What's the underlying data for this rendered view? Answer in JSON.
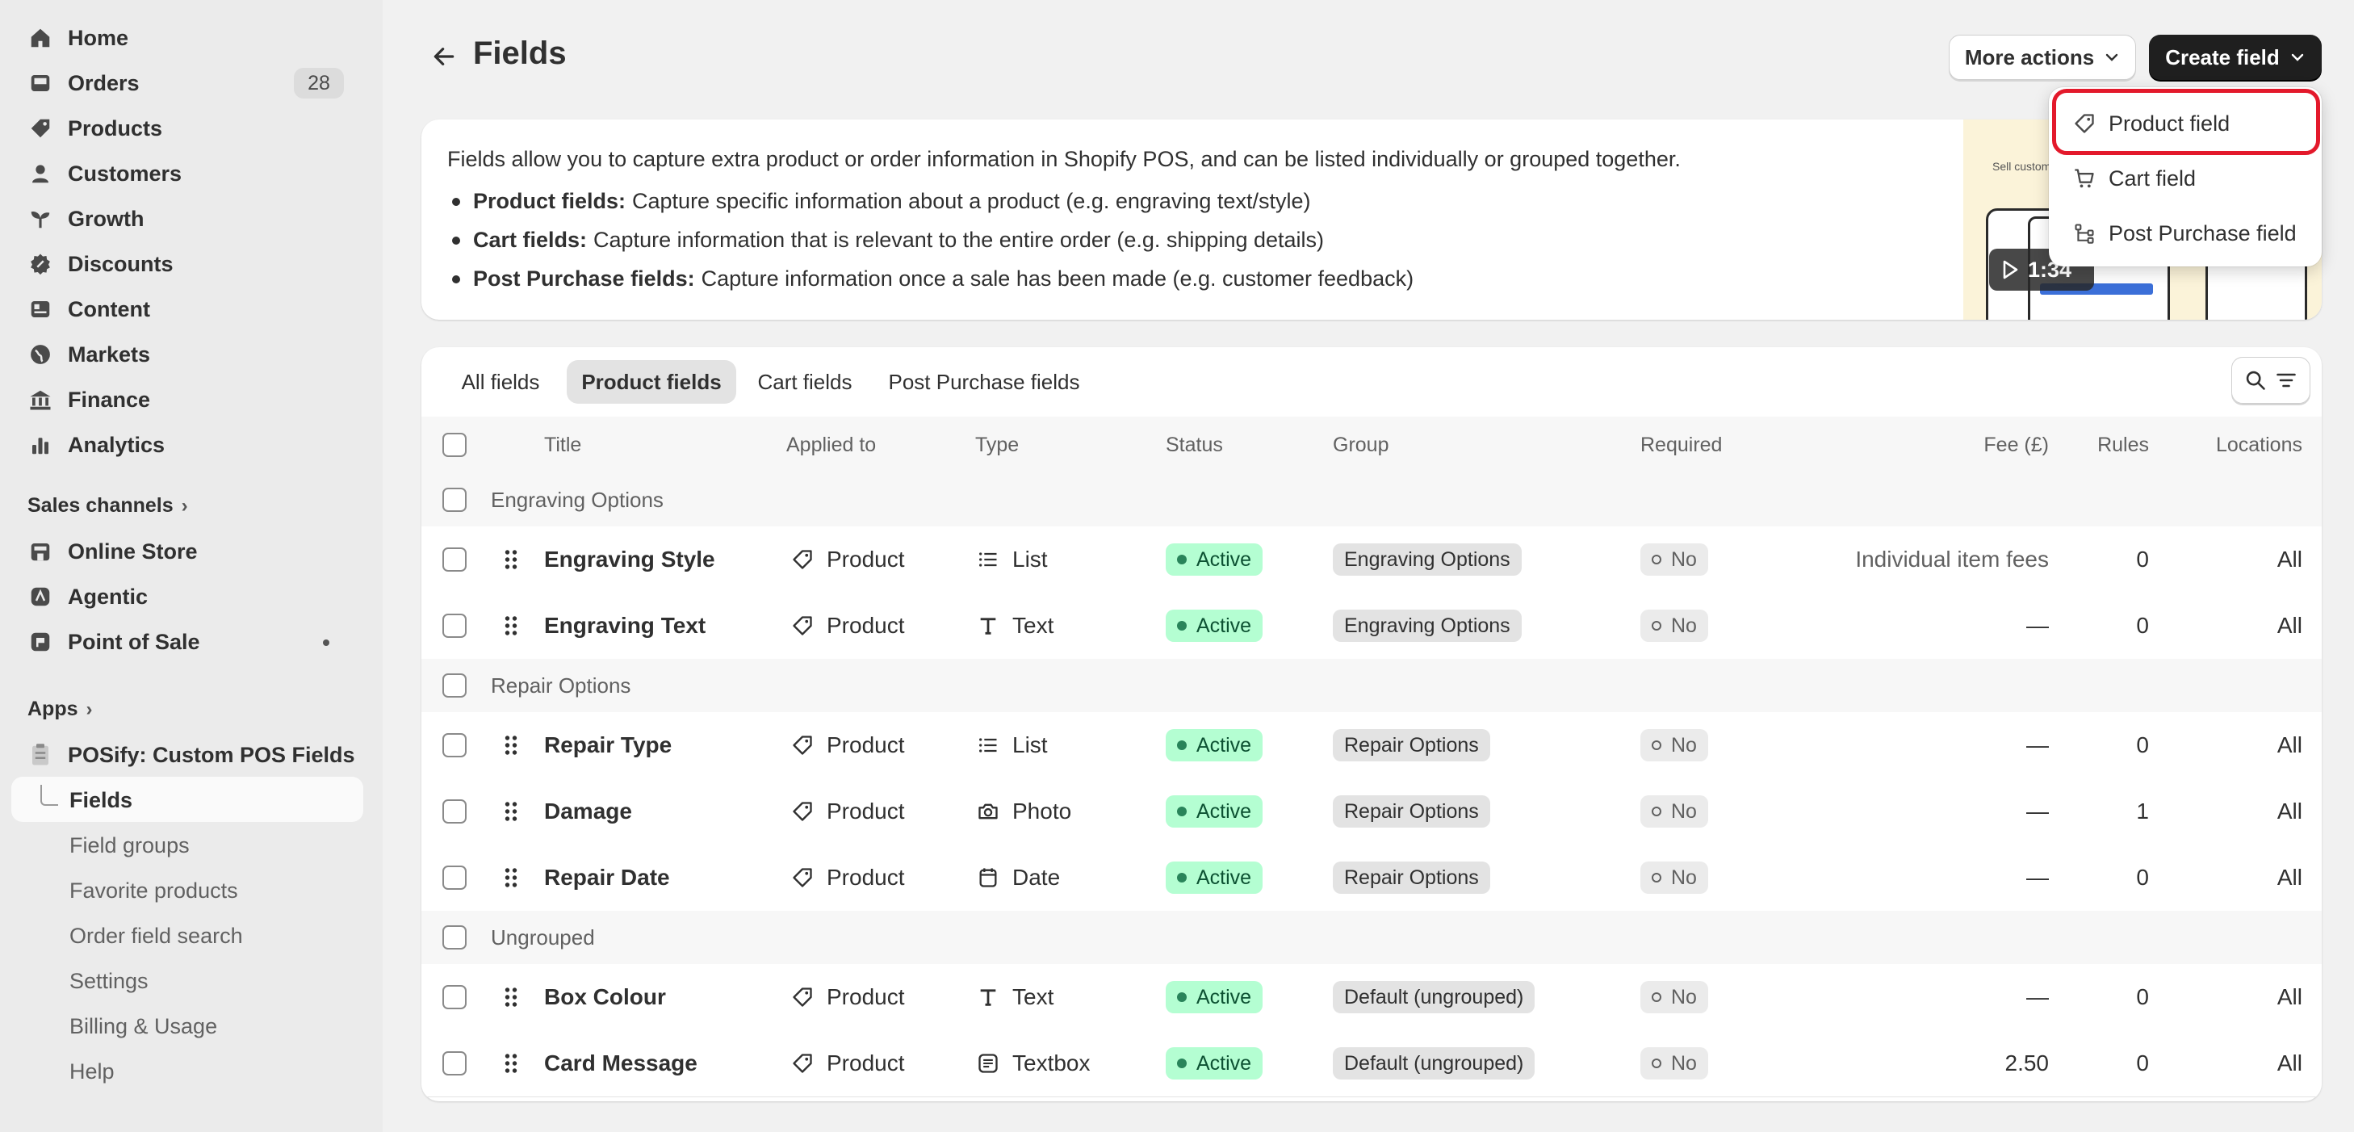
{
  "sidebar": {
    "items": [
      {
        "label": "Home",
        "icon": "home-icon"
      },
      {
        "label": "Orders",
        "icon": "inbox-icon",
        "badge": "28"
      },
      {
        "label": "Products",
        "icon": "tag-icon"
      },
      {
        "label": "Customers",
        "icon": "person-icon"
      },
      {
        "label": "Growth",
        "icon": "growth-icon"
      },
      {
        "label": "Discounts",
        "icon": "discount-icon"
      },
      {
        "label": "Content",
        "icon": "content-icon"
      },
      {
        "label": "Markets",
        "icon": "globe-icon"
      },
      {
        "label": "Finance",
        "icon": "bank-icon"
      },
      {
        "label": "Analytics",
        "icon": "chart-icon"
      }
    ],
    "sales_channels_label": "Sales channels",
    "channels": [
      {
        "label": "Online Store",
        "icon": "store-icon"
      },
      {
        "label": "Agentic",
        "icon": "agentic-icon"
      },
      {
        "label": "Point of Sale",
        "icon": "pos-icon"
      }
    ],
    "apps_label": "Apps",
    "app_name": "POSify: Custom POS Fields",
    "app_items": [
      "Fields",
      "Field groups",
      "Favorite products",
      "Order field search",
      "Settings",
      "Billing & Usage",
      "Help"
    ]
  },
  "header": {
    "title": "Fields",
    "more_actions": "More actions",
    "create_field": "Create field"
  },
  "dropdown": {
    "items": [
      {
        "label": "Product field",
        "icon": "tag-icon"
      },
      {
        "label": "Cart field",
        "icon": "cart-icon"
      },
      {
        "label": "Post Purchase field",
        "icon": "flow-icon"
      }
    ]
  },
  "info": {
    "intro": "Fields allow you to capture extra product or order information in Shopify POS, and can be listed individually or grouped together.",
    "bullets": [
      {
        "bold": "Product fields:",
        "text": "Capture specific information about a product (e.g. engraving text/style)"
      },
      {
        "bold": "Cart fields:",
        "text": "Capture information that is relevant to the entire order (e.g. shipping details)"
      },
      {
        "bold": "Post Purchase fields:",
        "text": "Capture information once a sale has been made (e.g. customer feedback)"
      }
    ],
    "video_duration": "1:34",
    "video_caption": "Sell custom..."
  },
  "tabs": [
    "All fields",
    "Product fields",
    "Cart fields",
    "Post Purchase fields"
  ],
  "active_tab": "Product fields",
  "table": {
    "columns": {
      "title": "Title",
      "applied_to": "Applied to",
      "type": "Type",
      "status": "Status",
      "group": "Group",
      "required": "Required",
      "fee": "Fee (£)",
      "rules": "Rules",
      "locations": "Locations"
    },
    "groups": [
      {
        "name": "Engraving Options",
        "rows": [
          {
            "title": "Engraving Style",
            "applied_to": "Product",
            "type": "List",
            "type_icon": "list-icon",
            "status": "Active",
            "group": "Engraving Options",
            "required": "No",
            "fee": "Individual item fees",
            "rules": "0",
            "locations": "All"
          },
          {
            "title": "Engraving Text",
            "applied_to": "Product",
            "type": "Text",
            "type_icon": "text-icon",
            "status": "Active",
            "group": "Engraving Options",
            "required": "No",
            "fee": "—",
            "rules": "0",
            "locations": "All"
          }
        ]
      },
      {
        "name": "Repair Options",
        "rows": [
          {
            "title": "Repair Type",
            "applied_to": "Product",
            "type": "List",
            "type_icon": "list-icon",
            "status": "Active",
            "group": "Repair Options",
            "required": "No",
            "fee": "—",
            "rules": "0",
            "locations": "All"
          },
          {
            "title": "Damage",
            "applied_to": "Product",
            "type": "Photo",
            "type_icon": "camera-icon",
            "status": "Active",
            "group": "Repair Options",
            "required": "No",
            "fee": "—",
            "rules": "1",
            "locations": "All"
          },
          {
            "title": "Repair Date",
            "applied_to": "Product",
            "type": "Date",
            "type_icon": "calendar-icon",
            "status": "Active",
            "group": "Repair Options",
            "required": "No",
            "fee": "—",
            "rules": "0",
            "locations": "All"
          }
        ]
      },
      {
        "name": "Ungrouped",
        "rows": [
          {
            "title": "Box Colour",
            "applied_to": "Product",
            "type": "Text",
            "type_icon": "text-icon",
            "status": "Active",
            "group": "Default (ungrouped)",
            "required": "No",
            "fee": "—",
            "rules": "0",
            "locations": "All"
          },
          {
            "title": "Card Message",
            "applied_to": "Product",
            "type": "Textbox",
            "type_icon": "textbox-icon",
            "status": "Active",
            "group": "Default (ungrouped)",
            "required": "No",
            "fee": "2.50",
            "rules": "0",
            "locations": "All"
          }
        ]
      }
    ]
  },
  "colors": {
    "active_badge_bg": "#b4fed2",
    "active_dot": "#29845a",
    "highlight_border": "#e3192b",
    "primary_button": "#1f1f1f"
  }
}
